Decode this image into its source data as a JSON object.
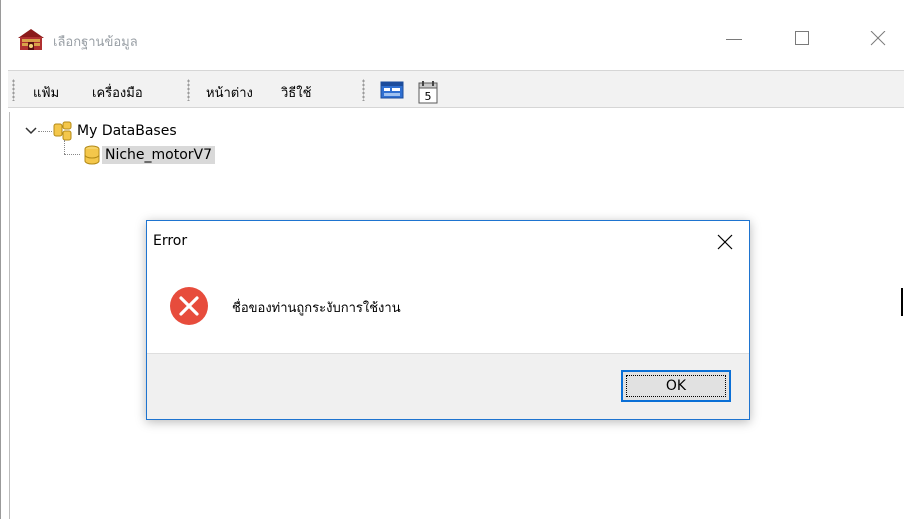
{
  "window": {
    "title": "เลือกฐานข้อมูล"
  },
  "menu": {
    "items": [
      {
        "label": "แฟ้ม"
      },
      {
        "label": "เครื่องมือ"
      },
      {
        "label": "หน้าต่าง"
      },
      {
        "label": "วิธีใช้"
      }
    ],
    "toolbar_icons": [
      "window-icon",
      "calendar-icon"
    ],
    "calendar_day": "5"
  },
  "tree": {
    "root": {
      "label": "My DataBases",
      "expanded": true
    },
    "children": [
      {
        "label": "Niche_motorV7",
        "selected": true
      }
    ]
  },
  "dialog": {
    "title": "Error",
    "message": "ชื่อของท่านถูกระงับการใช้งาน",
    "ok_label": "OK",
    "icon": "error-icon"
  },
  "colors": {
    "dialog_border": "#1e74d0",
    "error_red": "#e74c3c",
    "selection": "#d9d9d9"
  }
}
